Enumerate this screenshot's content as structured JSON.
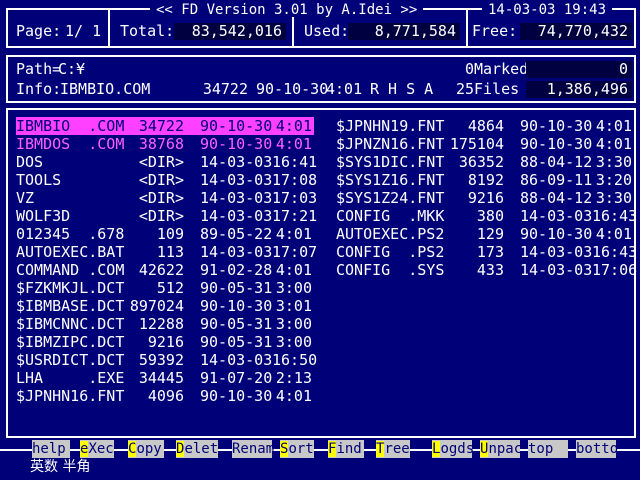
{
  "header": {
    "title": "<< FD Version 3.01 by A.Idei >>",
    "datetime": "14-03-03 19:43",
    "page_label": "Page:",
    "page_value": "1/ 1",
    "total_label": "Total:",
    "total_value": "83,542,016",
    "used_label": "Used:",
    "used_value": "8,771,584",
    "free_label": "Free:",
    "free_value": "74,770,432"
  },
  "info": {
    "path_label": "Path=",
    "path_value": "C:¥",
    "marked_count": "0",
    "marked_label": "Marked",
    "marked_value": "0",
    "info_label": "Info:",
    "info_name": "IBMBIO.COM",
    "info_size": "34722",
    "info_date": "90-10-30",
    "info_time": "4:01",
    "info_attr": "R H S A",
    "files_count": "25",
    "files_label": "Files",
    "files_value": "1,386,496"
  },
  "files_left": [
    {
      "name": "IBMBIO  .COM",
      "size": "34722",
      "date": "90-10-30",
      "time": "4:01"
    },
    {
      "name": "IBMDOS  .COM",
      "size": "38768",
      "date": "90-10-30",
      "time": "4:01"
    },
    {
      "name": "DOS",
      "size": "<DIR>",
      "date": "14-03-03",
      "time": "16:41"
    },
    {
      "name": "TOOLS",
      "size": "<DIR>",
      "date": "14-03-03",
      "time": "17:08"
    },
    {
      "name": "VZ",
      "size": "<DIR>",
      "date": "14-03-03",
      "time": "17:03"
    },
    {
      "name": "WOLF3D",
      "size": "<DIR>",
      "date": "14-03-03",
      "time": "17:21"
    },
    {
      "name": "012345  .678",
      "size": "109",
      "date": "89-05-22",
      "time": "4:01"
    },
    {
      "name": "AUTOEXEC.BAT",
      "size": "113",
      "date": "14-03-03",
      "time": "17:07"
    },
    {
      "name": "COMMAND .COM",
      "size": "42622",
      "date": "91-02-28",
      "time": "4:01"
    },
    {
      "name": "$FZKMKJL.DCT",
      "size": "512",
      "date": "90-05-31",
      "time": "3:00"
    },
    {
      "name": "$IBMBASE.DCT",
      "size": "897024",
      "date": "90-10-30",
      "time": "3:01"
    },
    {
      "name": "$IBMCNNC.DCT",
      "size": "12288",
      "date": "90-05-31",
      "time": "3:00"
    },
    {
      "name": "$IBMZIPC.DCT",
      "size": "9216",
      "date": "90-05-31",
      "time": "3:00"
    },
    {
      "name": "$USRDICT.DCT",
      "size": "59392",
      "date": "14-03-03",
      "time": "16:50"
    },
    {
      "name": "LHA     .EXE",
      "size": "34445",
      "date": "91-07-20",
      "time": "2:13"
    },
    {
      "name": "$JPNHN16.FNT",
      "size": "4096",
      "date": "90-10-30",
      "time": "4:01"
    }
  ],
  "files_right": [
    {
      "name": "$JPNHN19.FNT",
      "size": "4864",
      "date": "90-10-30",
      "time": "4:01"
    },
    {
      "name": "$JPNZN16.FNT",
      "size": "175104",
      "date": "90-10-30",
      "time": "4:01"
    },
    {
      "name": "$SYS1DIC.FNT",
      "size": "36352",
      "date": "88-04-12",
      "time": "3:30"
    },
    {
      "name": "$SYS1Z16.FNT",
      "size": "8192",
      "date": "86-09-11",
      "time": "3:20"
    },
    {
      "name": "$SYS1Z24.FNT",
      "size": "9216",
      "date": "88-04-12",
      "time": "3:30"
    },
    {
      "name": "CONFIG  .MKK",
      "size": "380",
      "date": "14-03-03",
      "time": "16:43"
    },
    {
      "name": "AUTOEXEC.PS2",
      "size": "129",
      "date": "90-10-30",
      "time": "4:01"
    },
    {
      "name": "CONFIG  .PS2",
      "size": "173",
      "date": "14-03-03",
      "time": "16:43"
    },
    {
      "name": "CONFIG  .SYS",
      "size": "433",
      "date": "14-03-03",
      "time": "17:06"
    }
  ],
  "fkeys": [
    {
      "hot": "",
      "rest": "help"
    },
    {
      "hot": "e",
      "rest": "Xec"
    },
    {
      "hot": "C",
      "rest": "opy"
    },
    {
      "hot": "D",
      "rest": "elet"
    },
    {
      "hot": "",
      "rest": "Renam"
    },
    {
      "hot": "S",
      "rest": "ort"
    },
    {
      "hot": "F",
      "rest": "ind"
    },
    {
      "hot": "T",
      "rest": "ree"
    },
    {
      "hot": "L",
      "rest": "ogds"
    },
    {
      "hot": "U",
      "rest": "npac"
    },
    {
      "hot": "",
      "rest": "top"
    },
    {
      "hot": "",
      "rest": "botto"
    }
  ],
  "status": "英数 半角",
  "colors": {
    "background": "#000078",
    "text": "#ffffff",
    "selection": "#ff40ff",
    "system_file": "#ff60ff",
    "fkey_bg": "#c8c8c8",
    "fkey_hot": "#ffff00"
  }
}
